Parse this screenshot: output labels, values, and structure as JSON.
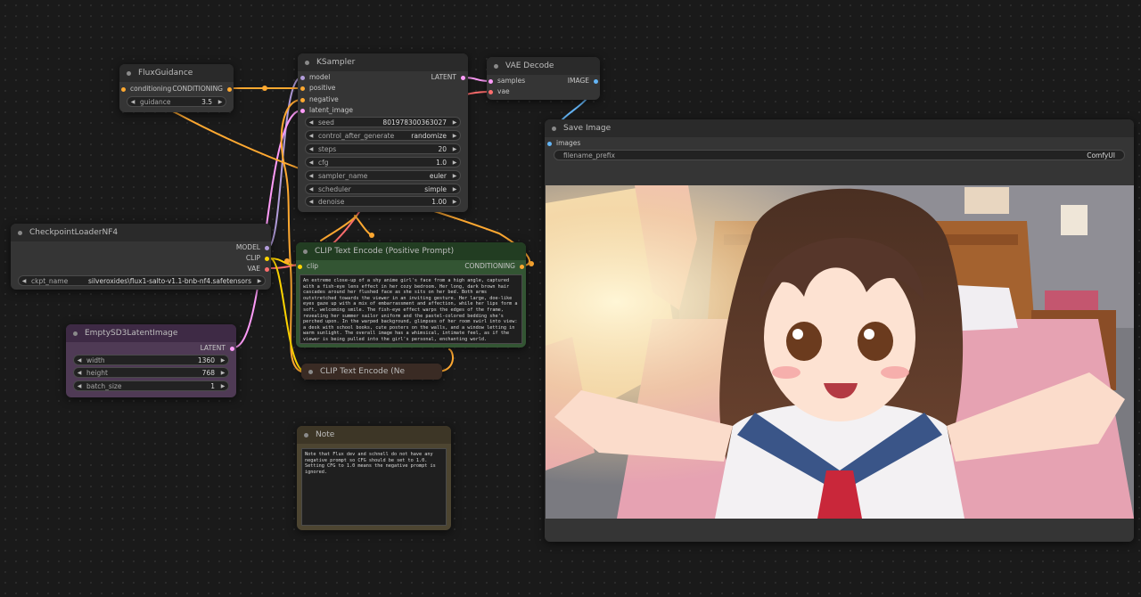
{
  "flux_guidance": {
    "title": "FluxGuidance",
    "input_conditioning": "conditioning",
    "output_conditioning": "CONDITIONING",
    "guidance_label": "guidance",
    "guidance_value": "3.5"
  },
  "ksampler": {
    "title": "KSampler",
    "inputs": [
      "model",
      "positive",
      "negative",
      "latent_image"
    ],
    "output": "LATENT",
    "widgets": [
      {
        "label": "seed",
        "value": "801978300363027"
      },
      {
        "label": "control_after_generate",
        "value": "randomize"
      },
      {
        "label": "steps",
        "value": "20"
      },
      {
        "label": "cfg",
        "value": "1.0"
      },
      {
        "label": "sampler_name",
        "value": "euler"
      },
      {
        "label": "scheduler",
        "value": "simple"
      },
      {
        "label": "denoise",
        "value": "1.00"
      }
    ]
  },
  "vae_decode": {
    "title": "VAE Decode",
    "input_samples": "samples",
    "input_vae": "vae",
    "output": "IMAGE"
  },
  "save_image": {
    "title": "Save Image",
    "input": "images",
    "prefix_label": "filename_prefix",
    "prefix_value": "ComfyUI"
  },
  "checkpoint_loader": {
    "title": "CheckpointLoaderNF4",
    "outputs": [
      "MODEL",
      "CLIP",
      "VAE"
    ],
    "ckpt_label": "ckpt_name",
    "ckpt_value": "silveroxides\\flux1-salto-v1.1-bnb-nf4.safetensors"
  },
  "clip_positive": {
    "title": "CLIP Text Encode (Positive Prompt)",
    "input": "clip",
    "output": "CONDITIONING",
    "text": "An extreme close-up of a shy anime girl's face from a high angle, captured with a fish-eye lens effect in her cozy bedroom. Her long, dark brown hair cascades around her flushed face as she sits on her bed. Both arms outstretched towards the viewer in an inviting gesture. Her large, doe-like eyes gaze up with a mix of embarrassment and affection, while her lips form a soft, welcoming smile. The fish-eye effect warps the edges of the frame, revealing her summer sailor uniform and the pastel-colored bedding she's perched upon. In the warped background, glimpses of her room swirl into view: a desk with school books, cute posters on the walls, and a window letting in warm sunlight. The overall image has a whimsical, intimate feel, as if the viewer is being pulled into the girl's personal, enchanting world."
  },
  "clip_negative": {
    "title": "CLIP Text Encode (Ne"
  },
  "empty_latent": {
    "title": "EmptySD3LatentImage",
    "output": "LATENT",
    "widgets": [
      {
        "label": "width",
        "value": "1360"
      },
      {
        "label": "height",
        "value": "768"
      },
      {
        "label": "batch_size",
        "value": "1"
      }
    ]
  },
  "note": {
    "title": "Note",
    "text": "Note that Flux dev and schnell do not have any negative prompt so CFG should be set to 1.0. Setting CFG to 1.0 means the negative prompt is ignored."
  },
  "colors": {
    "model": "#b39ddb",
    "clip": "#ffd500",
    "vae": "#ff6e6e",
    "latent": "#ff9cf9",
    "conditioning": "#ffa931",
    "image": "#64b5f6",
    "clip_node_bg": "#335533",
    "empty_latent_bg": "#4f3a55",
    "note_bg": "#4d4531"
  }
}
